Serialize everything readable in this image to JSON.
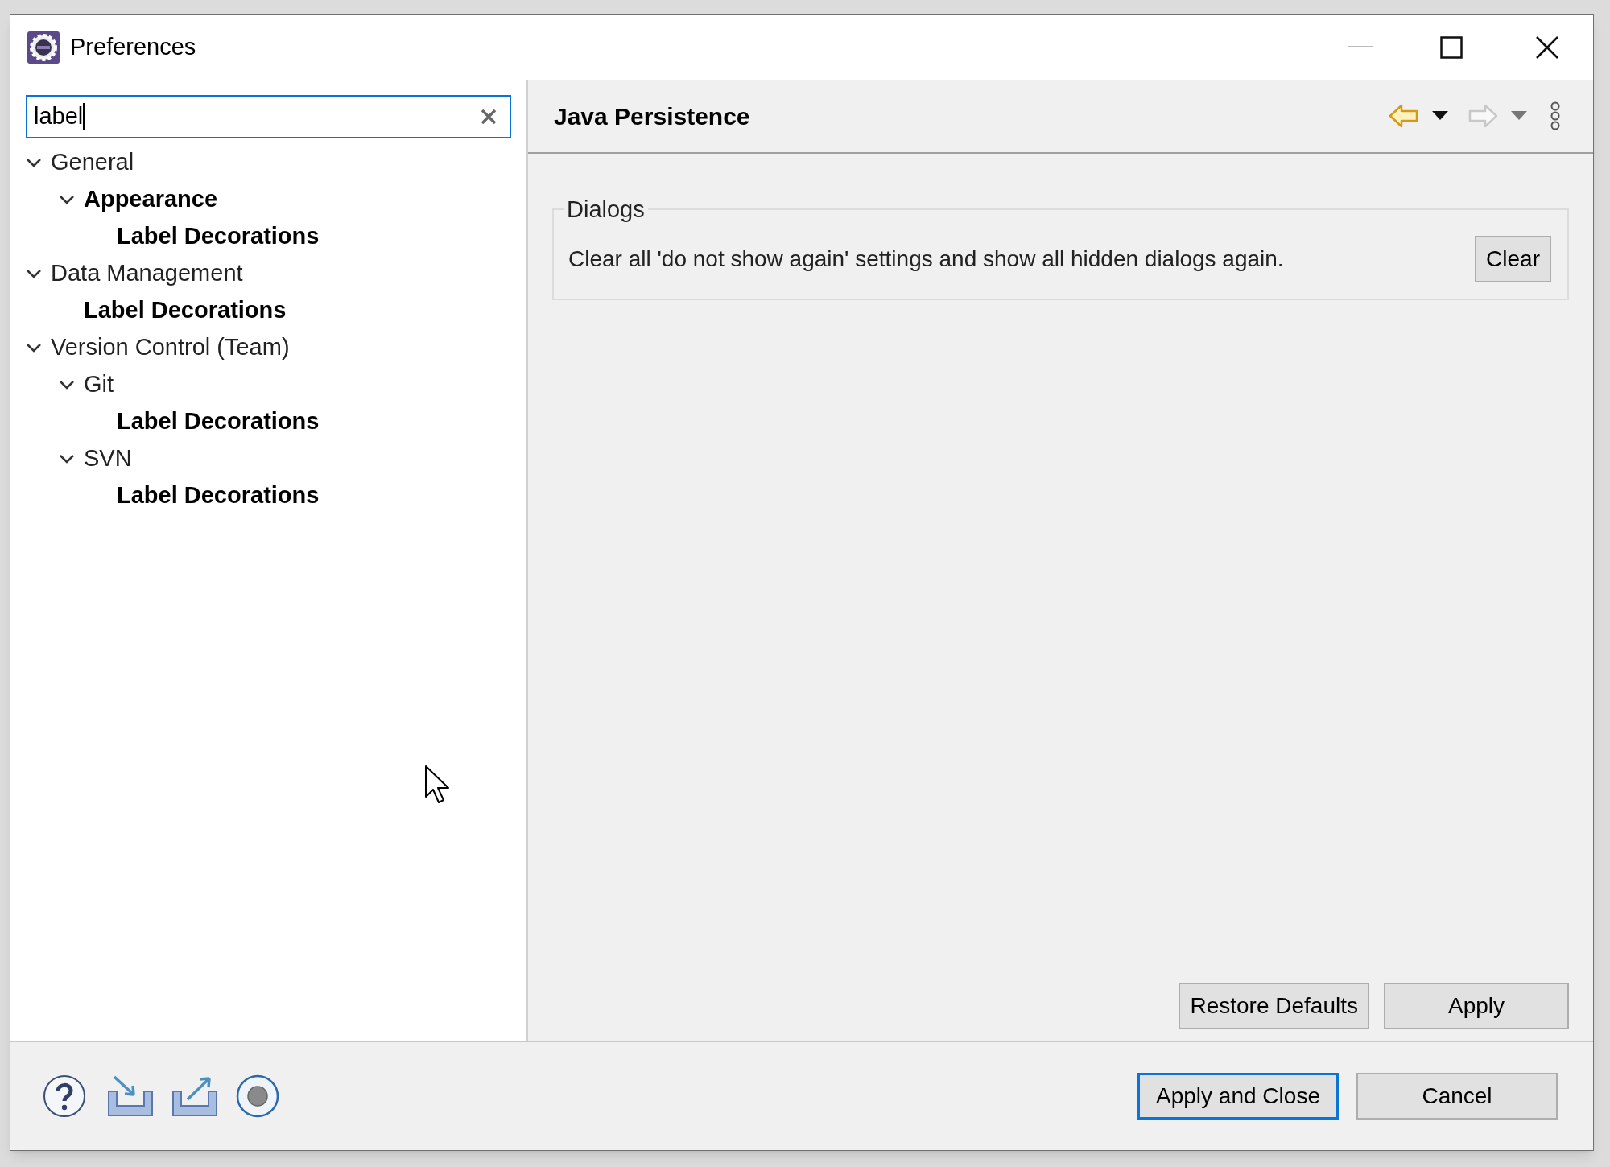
{
  "window": {
    "title": "Preferences"
  },
  "search": {
    "value": "label"
  },
  "tree": [
    {
      "label": "General",
      "expanded": true,
      "matched": false,
      "children": [
        {
          "label": "Appearance",
          "expanded": true,
          "matched": true,
          "children": [
            {
              "label": "Label Decorations",
              "matched": true
            }
          ]
        }
      ]
    },
    {
      "label": "Data Management",
      "expanded": true,
      "matched": false,
      "children": [
        {
          "label": "Label Decorations",
          "matched": true
        }
      ]
    },
    {
      "label": "Version Control (Team)",
      "expanded": true,
      "matched": false,
      "children": [
        {
          "label": "Git",
          "expanded": true,
          "matched": false,
          "children": [
            {
              "label": "Label Decorations",
              "matched": true
            }
          ]
        },
        {
          "label": "SVN",
          "expanded": true,
          "matched": false,
          "children": [
            {
              "label": "Label Decorations",
              "matched": true
            }
          ]
        }
      ]
    }
  ],
  "page": {
    "title": "Java Persistence",
    "back_enabled": true,
    "forward_enabled": false
  },
  "group": {
    "title": "Dialogs",
    "text": "Clear all 'do not show again' settings and show all hidden dialogs again.",
    "button": "Clear"
  },
  "page_buttons": [
    "Restore Defaults",
    "Apply"
  ],
  "dialog_buttons": [
    {
      "label": "Apply and Close",
      "default": true
    },
    {
      "label": "Cancel",
      "default": false
    }
  ]
}
